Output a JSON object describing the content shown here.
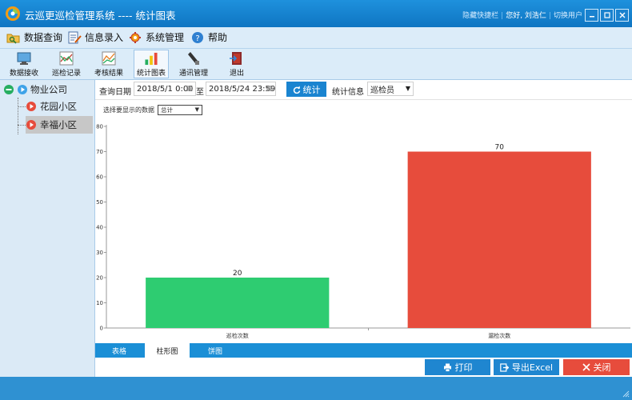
{
  "window": {
    "title": "云巡更巡检管理系统 ---- 统计图表",
    "links": [
      "隐藏快捷栏",
      "您好, 刘浩仁",
      "切换用户"
    ]
  },
  "menu": [
    {
      "label": "数据查询",
      "icon": "search-folder-icon"
    },
    {
      "label": "信息录入",
      "icon": "edit-document-icon"
    },
    {
      "label": "系统管理",
      "icon": "gear-icon"
    },
    {
      "label": "帮助",
      "icon": "help-icon"
    }
  ],
  "toolbar": [
    {
      "label": "数据接收",
      "icon": "monitor-icon",
      "active": false
    },
    {
      "label": "巡检记录",
      "icon": "chart-record-icon",
      "active": false
    },
    {
      "label": "考核结果",
      "icon": "chart-result-icon",
      "active": false
    },
    {
      "label": "统计图表",
      "icon": "bar-chart-icon",
      "active": true
    },
    {
      "label": "通讯管理",
      "icon": "device-icon",
      "active": false
    },
    {
      "label": "退出",
      "icon": "exit-icon",
      "active": false
    }
  ],
  "tree": {
    "root": "物业公司",
    "children": [
      {
        "label": "花园小区",
        "selected": false
      },
      {
        "label": "幸福小区",
        "selected": true
      }
    ]
  },
  "filter": {
    "date_label": "查询日期",
    "start": "2018/5/1 0:00",
    "to": "至",
    "end": "2018/5/24 23:59",
    "stat_button": "统计",
    "info_label": "统计信息",
    "info_value": "巡检员"
  },
  "chart_options": {
    "label": "选择要显示的数据",
    "value": "总计"
  },
  "chart_data": {
    "type": "bar",
    "categories": [
      "巡检次数",
      "漏检次数"
    ],
    "values": [
      20,
      70
    ],
    "colors": [
      "#2ecc71",
      "#e74c3c"
    ],
    "ylim": [
      0,
      80
    ],
    "yticks": [
      0,
      10,
      20,
      30,
      40,
      50,
      60,
      70,
      80
    ]
  },
  "tabs": [
    {
      "label": "表格",
      "active": false
    },
    {
      "label": "柱形图",
      "active": true
    },
    {
      "label": "饼图",
      "active": false
    }
  ],
  "actions": {
    "print": "打印",
    "export": "导出Excel",
    "close": "关闭"
  }
}
